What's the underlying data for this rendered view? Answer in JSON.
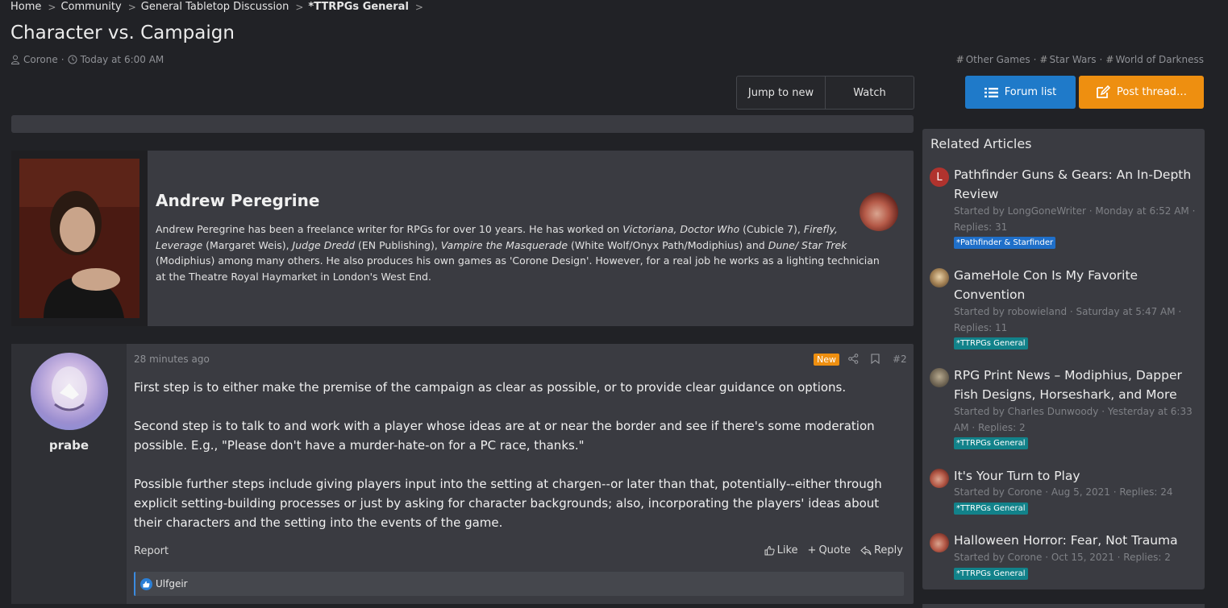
{
  "breadcrumb": {
    "items": [
      "Home",
      "Community",
      "General Tabletop Discussion",
      "*TTRPGs General"
    ]
  },
  "thread": {
    "title": "Character vs. Campaign",
    "author": "Corone",
    "date": "Today at 6:00 AM",
    "tags": [
      "Other Games",
      "Star Wars",
      "World of Darkness"
    ]
  },
  "actions": {
    "jump_to_new": "Jump to new",
    "watch": "Watch",
    "forum_list": "Forum list",
    "post_thread": "Post thread…"
  },
  "author_block": {
    "name": "Andrew Peregrine",
    "bio_parts": {
      "p1": "Andrew Peregrine has been a freelance writer for RPGs for over 10 years. He has worked on ",
      "i1": "Victoriana, Doctor Who",
      "p2": " (Cubicle 7), ",
      "i2": "Firefly, Leverage",
      "p3": " (Margaret Weis), ",
      "i3": "Judge Dredd",
      "p4": " (EN Publishing), ",
      "i4": "Vampire the Masquerade",
      "p5": " (White Wolf/Onyx Path/Modiphius) and ",
      "i5": "Dune/ Star Trek",
      "p6": " (Modiphius) among many others. He also produces his own games as 'Corone Design'. However, for a real job he works as a lighting technician at the Theatre Royal Haymarket in London's West End."
    }
  },
  "post": {
    "username": "prabe",
    "time": "28 minutes ago",
    "badge": "New",
    "number": "#2",
    "paragraphs": [
      "First step is to either make the premise of the campaign as clear as possible, or to provide clear guidance on options.",
      "Second step is to talk to and work with a player whose ideas are at or near the border and see if there's some moderation possible. E.g., \"Please don't have a murder-hate-on for a PC race, thanks.\"",
      "Possible further steps include giving players input into the setting at chargen--or later than that, potentially--either through explicit setting-building processes or just by asking for character backgrounds; also, incorporating the players' ideas about their characters and the setting into the events of the game."
    ],
    "report": "Report",
    "like": "Like",
    "quote": "Quote",
    "reply": "Reply",
    "reaction_user": "Ulfgeir"
  },
  "sidebar": {
    "title": "Related Articles",
    "articles": [
      {
        "title": "Pathfinder Guns & Gears: An In-Depth Review",
        "meta": "Started by LongGoneWriter · Monday at 6:52 AM · Replies: 31",
        "tag": "*Pathfinder & Starfinder",
        "avatar_letter": "L"
      },
      {
        "title": "GameHole Con Is My Favorite Convention",
        "meta": "Started by robowieland · Saturday at 5:47 AM · Replies: 11",
        "tag": "*TTRPGs General"
      },
      {
        "title": "RPG Print News – Modiphius, Dapper Fish Designs, Horseshark, and More",
        "meta": "Started by Charles Dunwoody · Yesterday at 6:33 AM · Replies: 2",
        "tag": "*TTRPGs General"
      },
      {
        "title": "It's Your Turn to Play",
        "meta": "Started by Corone · Aug 5, 2021 · Replies: 24",
        "tag": "*TTRPGs General"
      },
      {
        "title": "Halloween Horror: Fear, Not Trauma",
        "meta": "Started by Corone · Oct 15, 2021 · Replies: 2",
        "tag": "*TTRPGs General"
      }
    ]
  },
  "colors": {
    "background": "#212226",
    "panel": "#3a3b41",
    "accent_blue": "#1f7ac9",
    "accent_orange": "#ee8f10",
    "tag_teal": "#12828a",
    "tag_blue": "#1f6fc9"
  }
}
